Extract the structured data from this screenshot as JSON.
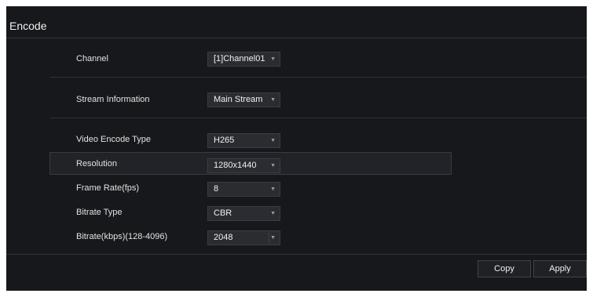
{
  "page": {
    "title": "Encode"
  },
  "fields": {
    "channel": {
      "label": "Channel",
      "value": "[1]Channel01"
    },
    "stream_information": {
      "label": "Stream Information",
      "value": "Main Stream"
    },
    "video_encode_type": {
      "label": "Video Encode Type",
      "value": "H265"
    },
    "resolution": {
      "label": "Resolution",
      "value": "1280x1440"
    },
    "frame_rate": {
      "label": "Frame Rate(fps)",
      "value": "8"
    },
    "bitrate_type": {
      "label": "Bitrate Type",
      "value": "CBR"
    },
    "bitrate": {
      "label": "Bitrate(kbps)(128-4096)",
      "value": "2048"
    }
  },
  "buttons": {
    "copy": "Copy",
    "apply": "Apply"
  },
  "icons": {
    "dropdown": "chevron-down-icon"
  },
  "colors": {
    "background": "#17181b",
    "field_background": "#2a2c31",
    "border": "#3a3d43",
    "text": "#e6e6e6"
  }
}
